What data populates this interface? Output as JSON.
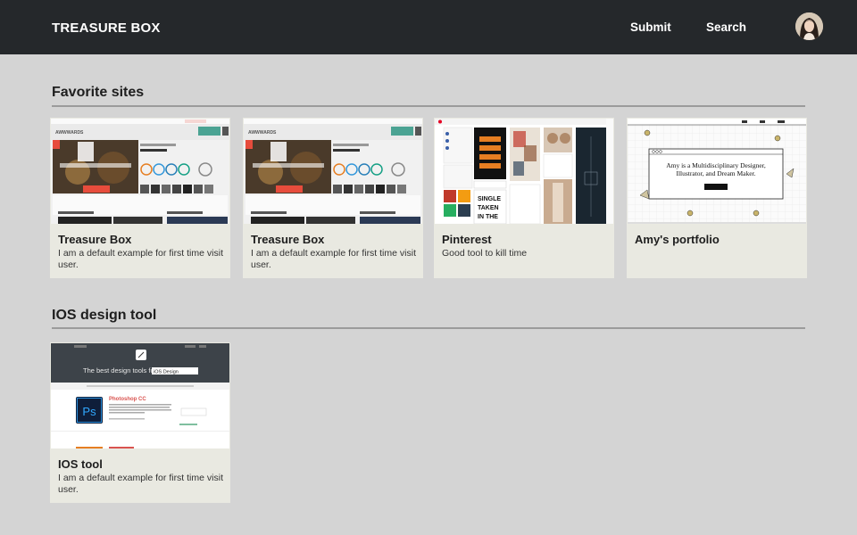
{
  "header": {
    "brand": "TREASURE BOX",
    "nav": {
      "submit": "Submit",
      "search": "Search"
    },
    "colors": {
      "bar": "#25282b",
      "text": "#ffffff"
    }
  },
  "sections": [
    {
      "title": "Favorite sites",
      "cards": [
        {
          "title": "Treasure Box",
          "description": "I am a default example for first time visit user.",
          "thumbnail": "awwwards-screenshot"
        },
        {
          "title": "Treasure Box",
          "description": "I am a default example for first time visit user.",
          "thumbnail": "awwwards-screenshot"
        },
        {
          "title": "Pinterest",
          "description": "Good tool to kill time",
          "thumbnail": "pinterest-screenshot"
        },
        {
          "title": "Amy's portfolio",
          "description": "",
          "thumbnail": "portfolio-screenshot"
        }
      ]
    },
    {
      "title": "IOS design tool",
      "cards": [
        {
          "title": "IOS tool",
          "description": "I am a default example for first time visit user.",
          "thumbnail": "design-tools-screenshot"
        }
      ]
    }
  ],
  "thumb_text": {
    "awwwards_logo": "AWWWARDS",
    "portfolio_line1": "Amy is a Multidisciplinary Designer,",
    "portfolio_line2": "Illustrator, and Dream Maker.",
    "tools_heading": "The best design tools for",
    "tools_select": "iOS Design",
    "tools_app": "Photoshop CC",
    "tools_app_icon": "Ps",
    "pin_poster_1": "SINGLE",
    "pin_poster_2": "TAKEN",
    "pin_poster_3": "IN THE"
  },
  "colors": {
    "page_bg": "#d4d4d4",
    "card_bg": "#e9e9e1",
    "divider": "#9b9b9b"
  }
}
